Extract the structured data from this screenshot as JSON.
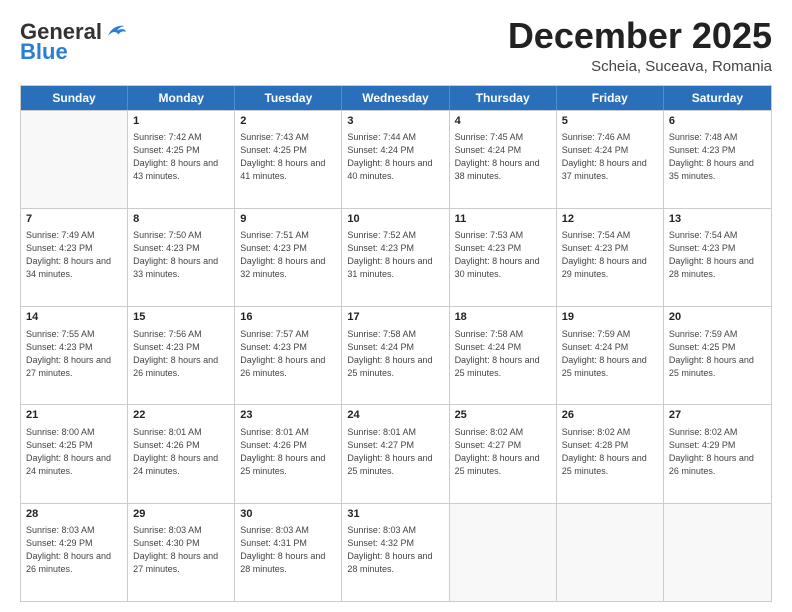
{
  "header": {
    "logo_general": "General",
    "logo_blue": "Blue",
    "month_title": "December 2025",
    "subtitle": "Scheia, Suceava, Romania"
  },
  "weekdays": [
    "Sunday",
    "Monday",
    "Tuesday",
    "Wednesday",
    "Thursday",
    "Friday",
    "Saturday"
  ],
  "rows": [
    [
      {
        "day": "",
        "empty": true
      },
      {
        "day": "1",
        "sunrise": "7:42 AM",
        "sunset": "4:25 PM",
        "daylight": "8 hours and 43 minutes."
      },
      {
        "day": "2",
        "sunrise": "7:43 AM",
        "sunset": "4:25 PM",
        "daylight": "8 hours and 41 minutes."
      },
      {
        "day": "3",
        "sunrise": "7:44 AM",
        "sunset": "4:24 PM",
        "daylight": "8 hours and 40 minutes."
      },
      {
        "day": "4",
        "sunrise": "7:45 AM",
        "sunset": "4:24 PM",
        "daylight": "8 hours and 38 minutes."
      },
      {
        "day": "5",
        "sunrise": "7:46 AM",
        "sunset": "4:24 PM",
        "daylight": "8 hours and 37 minutes."
      },
      {
        "day": "6",
        "sunrise": "7:48 AM",
        "sunset": "4:23 PM",
        "daylight": "8 hours and 35 minutes."
      }
    ],
    [
      {
        "day": "7",
        "sunrise": "7:49 AM",
        "sunset": "4:23 PM",
        "daylight": "8 hours and 34 minutes."
      },
      {
        "day": "8",
        "sunrise": "7:50 AM",
        "sunset": "4:23 PM",
        "daylight": "8 hours and 33 minutes."
      },
      {
        "day": "9",
        "sunrise": "7:51 AM",
        "sunset": "4:23 PM",
        "daylight": "8 hours and 32 minutes."
      },
      {
        "day": "10",
        "sunrise": "7:52 AM",
        "sunset": "4:23 PM",
        "daylight": "8 hours and 31 minutes."
      },
      {
        "day": "11",
        "sunrise": "7:53 AM",
        "sunset": "4:23 PM",
        "daylight": "8 hours and 30 minutes."
      },
      {
        "day": "12",
        "sunrise": "7:54 AM",
        "sunset": "4:23 PM",
        "daylight": "8 hours and 29 minutes."
      },
      {
        "day": "13",
        "sunrise": "7:54 AM",
        "sunset": "4:23 PM",
        "daylight": "8 hours and 28 minutes."
      }
    ],
    [
      {
        "day": "14",
        "sunrise": "7:55 AM",
        "sunset": "4:23 PM",
        "daylight": "8 hours and 27 minutes."
      },
      {
        "day": "15",
        "sunrise": "7:56 AM",
        "sunset": "4:23 PM",
        "daylight": "8 hours and 26 minutes."
      },
      {
        "day": "16",
        "sunrise": "7:57 AM",
        "sunset": "4:23 PM",
        "daylight": "8 hours and 26 minutes."
      },
      {
        "day": "17",
        "sunrise": "7:58 AM",
        "sunset": "4:24 PM",
        "daylight": "8 hours and 25 minutes."
      },
      {
        "day": "18",
        "sunrise": "7:58 AM",
        "sunset": "4:24 PM",
        "daylight": "8 hours and 25 minutes."
      },
      {
        "day": "19",
        "sunrise": "7:59 AM",
        "sunset": "4:24 PM",
        "daylight": "8 hours and 25 minutes."
      },
      {
        "day": "20",
        "sunrise": "7:59 AM",
        "sunset": "4:25 PM",
        "daylight": "8 hours and 25 minutes."
      }
    ],
    [
      {
        "day": "21",
        "sunrise": "8:00 AM",
        "sunset": "4:25 PM",
        "daylight": "8 hours and 24 minutes."
      },
      {
        "day": "22",
        "sunrise": "8:01 AM",
        "sunset": "4:26 PM",
        "daylight": "8 hours and 24 minutes."
      },
      {
        "day": "23",
        "sunrise": "8:01 AM",
        "sunset": "4:26 PM",
        "daylight": "8 hours and 25 minutes."
      },
      {
        "day": "24",
        "sunrise": "8:01 AM",
        "sunset": "4:27 PM",
        "daylight": "8 hours and 25 minutes."
      },
      {
        "day": "25",
        "sunrise": "8:02 AM",
        "sunset": "4:27 PM",
        "daylight": "8 hours and 25 minutes."
      },
      {
        "day": "26",
        "sunrise": "8:02 AM",
        "sunset": "4:28 PM",
        "daylight": "8 hours and 25 minutes."
      },
      {
        "day": "27",
        "sunrise": "8:02 AM",
        "sunset": "4:29 PM",
        "daylight": "8 hours and 26 minutes."
      }
    ],
    [
      {
        "day": "28",
        "sunrise": "8:03 AM",
        "sunset": "4:29 PM",
        "daylight": "8 hours and 26 minutes."
      },
      {
        "day": "29",
        "sunrise": "8:03 AM",
        "sunset": "4:30 PM",
        "daylight": "8 hours and 27 minutes."
      },
      {
        "day": "30",
        "sunrise": "8:03 AM",
        "sunset": "4:31 PM",
        "daylight": "8 hours and 28 minutes."
      },
      {
        "day": "31",
        "sunrise": "8:03 AM",
        "sunset": "4:32 PM",
        "daylight": "8 hours and 28 minutes."
      },
      {
        "day": "",
        "empty": true
      },
      {
        "day": "",
        "empty": true
      },
      {
        "day": "",
        "empty": true
      }
    ]
  ]
}
